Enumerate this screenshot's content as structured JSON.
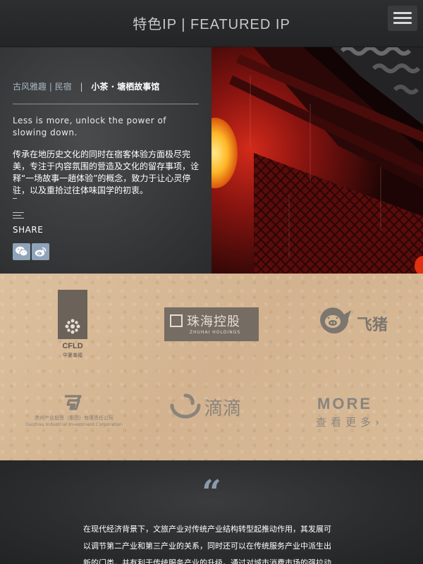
{
  "header": {
    "title": "特色IP | FEATURED IP",
    "menu_icon": "hamburger-icon"
  },
  "hero": {
    "category": "古风雅趣 | 民宿",
    "separator": "|",
    "subtitle": "小茶 · 塘栖故事馆",
    "slogan": "Less is more, unlock the power of slowing down.",
    "description": "传承在地历史文化的同时在宿客体验方面极尽完美，专注于内容氛围的营造及文化的留存事项，诠释“一场故事一趟体验”的概念，致力于让心灵停驻，以及重拾过往体味国学的初衷。",
    "dash": "–",
    "share_label": "SHARE",
    "social": [
      {
        "icon": "wechat-icon"
      },
      {
        "icon": "weibo-icon"
      }
    ]
  },
  "partners": {
    "cfld": {
      "name": "CFLD",
      "sub": "华夏幸福"
    },
    "zhuhai": {
      "name": "珠海控股",
      "sub": "ZHUHAI HOLDINGS"
    },
    "fliggy": {
      "name": "飞猪"
    },
    "guizhou": {
      "name": "贵州产业投资（集团）有限责任公司",
      "sub": "Guizhou Industrial Investment Corporation"
    },
    "didi": {
      "name": "滴滴"
    },
    "more": {
      "title": "MORE",
      "sub": "查看更多",
      "arrow": "›"
    }
  },
  "quote": {
    "mark": "“",
    "text": "在现代经济背景下，文旅产业对传统产业结构转型起推动作用，其发展可以调节第二产业和第三产业的关系，同时还可以在传统服务产业中派生出新的门类，并有利于传统服务产业的升级。通过对城市消费市场的强拉动"
  },
  "colors": {
    "accent": "#8fa4b9",
    "paper": "#d7b996",
    "dark": "#2b2c2e"
  }
}
